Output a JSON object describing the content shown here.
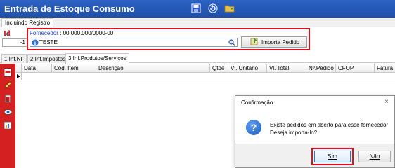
{
  "window": {
    "title": "Entrada de Estoque Consumo"
  },
  "toolbar": {
    "icons": [
      "save-icon",
      "undo-icon",
      "folder-icon"
    ]
  },
  "top_tabs": [
    {
      "label": "Incluindo Registro"
    }
  ],
  "header": {
    "id_label": "Id",
    "id_value": "-1",
    "fornecedor_label": "Fornecedor",
    "fornecedor_code": ": 00.000.000/0000-00",
    "fornecedor_value": "TESTE",
    "import_button": "Importa Pedido"
  },
  "tabs": [
    {
      "label": "1 Inf.NF"
    },
    {
      "label": "2 Inf.Impostos"
    },
    {
      "label": "3 Inf.Produtos/Serviços"
    }
  ],
  "grid": {
    "columns": [
      "Data",
      "Cód. Item",
      "Descrição",
      "Qtde",
      "Vl. Unitário",
      "Vl. Total",
      "Nº.Pedido",
      "CFOP",
      "Fatura"
    ]
  },
  "sidebar_icons": [
    "pdf-icon",
    "edit-icon",
    "delete-icon",
    "view-icon",
    "report-icon"
  ],
  "dialog": {
    "title": "Confirmação",
    "close": "×",
    "message_line1": "Existe pedidos em aberto para esse fornecedor",
    "message_line2": "Deseja importa-lo?",
    "yes": "Sim",
    "no": "Não"
  },
  "colors": {
    "titlebar": "#2d63c4",
    "highlight": "#e0101c",
    "sidebar": "#d42020",
    "label_blue": "#1a3fd6"
  }
}
